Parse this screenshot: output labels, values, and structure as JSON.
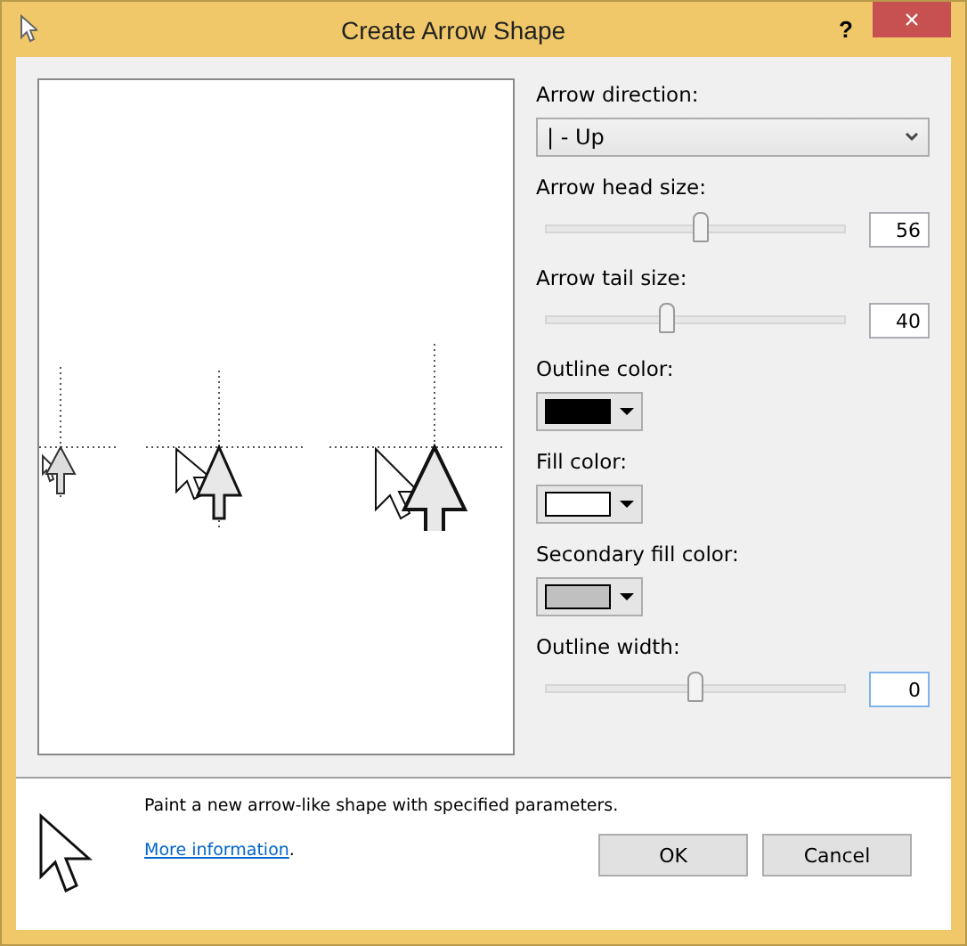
{
  "window": {
    "title": "Create Arrow Shape",
    "help": "?",
    "close": "×"
  },
  "settings": [
    {
      "kind": "dropdown",
      "label": "Arrow direction:",
      "value": "| - Up"
    },
    {
      "kind": "slider",
      "label": "Arrow head size:",
      "level": 0.52,
      "value": "56",
      "focused": false
    },
    {
      "kind": "slider",
      "label": "Arrow tail size:",
      "level": 0.41,
      "value": "40",
      "focused": false
    },
    {
      "kind": "color",
      "label": "Outline color:",
      "color": "#000000"
    },
    {
      "kind": "color",
      "label": "Fill color:",
      "color": "#ffffff"
    },
    {
      "kind": "color",
      "label": "Secondary fill color:",
      "color": "#c0c0c0"
    },
    {
      "kind": "slider",
      "label": "Outline width:",
      "level": 0.5,
      "value": "0",
      "focused": true
    }
  ],
  "footer": {
    "description": "Paint a new arrow-like shape with specified parameters.",
    "link": "More information",
    "link_suffix": ".",
    "buttons": [
      "OK",
      "Cancel"
    ]
  }
}
